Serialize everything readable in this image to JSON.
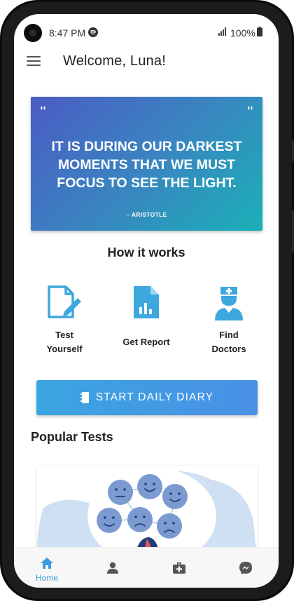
{
  "status_bar": {
    "time": "8:47 PM",
    "battery": "100%"
  },
  "app_bar": {
    "greeting": "Welcome, Luna!"
  },
  "quote": {
    "open_mark": "\"",
    "close_mark": "\"",
    "text": "IT IS DURING OUR DARKEST MOMENTS THAT WE MUST FOCUS TO SEE THE LIGHT.",
    "author": "– ARISTOTLE"
  },
  "how_it_works": {
    "title": "How it works",
    "items": [
      {
        "label": "Test Yourself",
        "icon": "edit-document-icon"
      },
      {
        "label": "Get Report",
        "icon": "report-chart-icon"
      },
      {
        "label": "Find Doctors",
        "icon": "doctor-icon"
      }
    ]
  },
  "diary_button": {
    "label": "START DAILY DIARY",
    "icon": "notebook-icon"
  },
  "popular_tests": {
    "title": "Popular Tests"
  },
  "bottom_nav": {
    "items": [
      {
        "label": "Home",
        "icon": "home-icon",
        "active": true
      },
      {
        "label": "",
        "icon": "person-icon"
      },
      {
        "label": "",
        "icon": "medical-kit-icon"
      },
      {
        "label": "",
        "icon": "messenger-icon"
      }
    ]
  },
  "colors": {
    "accent": "#3b9ddb",
    "icon_blue": "#3ea7dd",
    "card_blue": "#cfe0f3",
    "face_blue": "#7b9ad0"
  }
}
